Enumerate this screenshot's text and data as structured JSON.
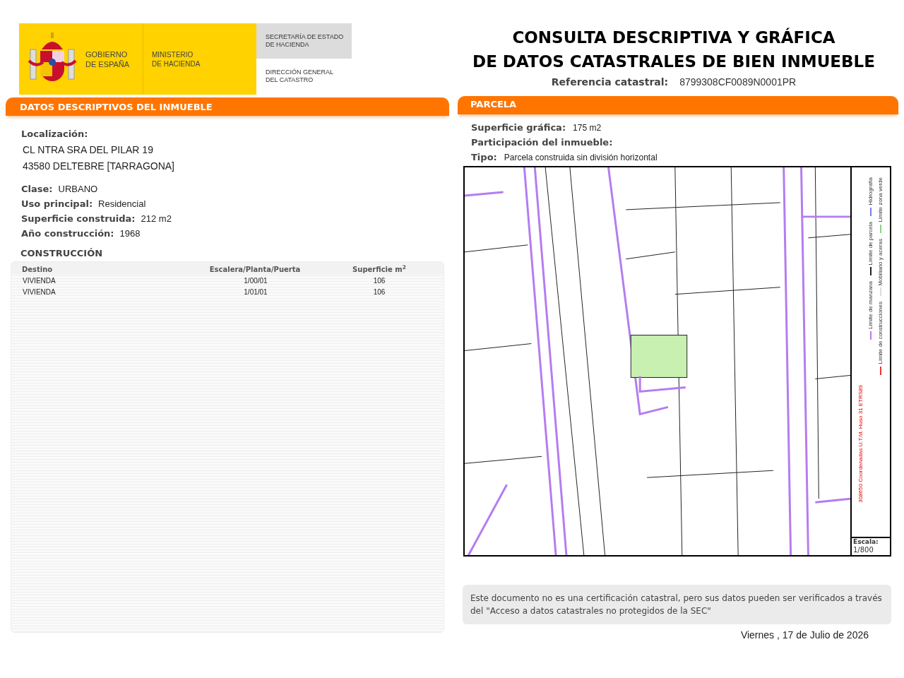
{
  "header": {
    "government": "GOBIERNO\nDE ESPAÑA",
    "ministry": "MINISTERIO\nDE HACIENDA",
    "secretariat": "SECRETARÍA DE ESTADO\nDE HACIENDA",
    "directorate": "DIRECCIÓN GENERAL\nDEL CATASTRO"
  },
  "title": [
    "CONSULTA DESCRIPTIVA Y GRÁFICA",
    "DE DATOS CATASTRALES DE BIEN INMUEBLE"
  ],
  "reference": {
    "label": "Referencia catastral:",
    "value": "8799308CF0089N0001PR"
  },
  "descriptive": {
    "heading": "DATOS DESCRIPTIVOS DEL INMUEBLE",
    "location_label": "Localización:",
    "location_lines": [
      "CL NTRA SRA DEL PILAR 19",
      "43580 DELTEBRE [TARRAGONA]"
    ],
    "fields": [
      {
        "label": "Clase:",
        "value": "URBANO"
      },
      {
        "label": "Uso principal:",
        "value": "Residencial"
      },
      {
        "label": "Superficie construida:",
        "value": "212 m2"
      },
      {
        "label": "Año construcción:",
        "value": "1968"
      }
    ],
    "construction_heading": "CONSTRUCCIÓN",
    "table": {
      "columns": [
        "Destino",
        "Escalera/Planta/Puerta",
        "Superficie m$^{2}$"
      ],
      "rows": [
        [
          "VIVIENDA",
          "1/00/01",
          "106"
        ],
        [
          "VIVIENDA",
          "1/01/01",
          "106"
        ]
      ]
    }
  },
  "parcel": {
    "heading": "PARCELA",
    "fields": [
      {
        "label": "Superficie gráfica:",
        "value": "175 m2"
      },
      {
        "label": "Participación del inmueble:"
      },
      {
        "label": "Tipo:",
        "value": "Parcela construida sin división horizontal"
      }
    ],
    "map": {
      "kind": "picture",
      "coordinates": "308650 Coordenadas U.T.M. Huso 31 ETRS89",
      "legend": [
        {
          "label": "Límite de manzana",
          "color": "#b57cf0"
        },
        {
          "label": "Límite de construcciones",
          "color": "#e53935"
        },
        {
          "label": "Límite de parcela",
          "color": "#222222"
        },
        {
          "label": "Mobiliario y aceras",
          "color": "#dddddd"
        },
        {
          "label": "Hidrografía",
          "color": "#7a7ae8"
        },
        {
          "label": "Límite zona verde",
          "color": "#8fd08f"
        }
      ],
      "scale_label": "Escala:",
      "scale": "1/800"
    }
  },
  "notice": "Este documento no es una certificación catastral, pero sus datos pueden ser verificados a través del \"Acceso a datos catastrales no protegidos de la SEC\"",
  "date": "Viernes , 17 de Julio de 2026"
}
